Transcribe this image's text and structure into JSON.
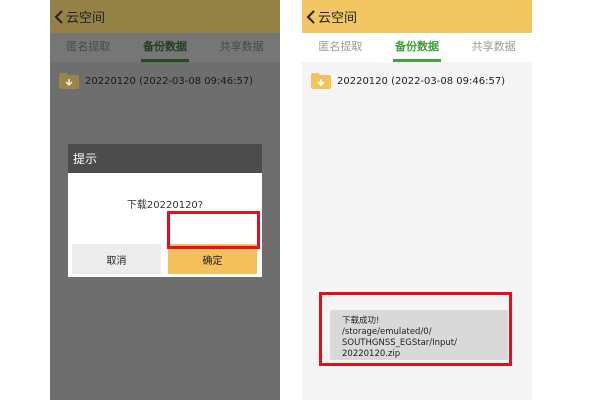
{
  "colors": {
    "header_bg": "#f2c662",
    "header_bg_dimmed": "#938146",
    "tabbar_bg": "#ffffff",
    "tabbar_bg_dimmed": "#767676",
    "content_bg": "#f5f5f5",
    "content_bg_dimmed": "#6e6e6e",
    "tab_active": "#3f9f3a",
    "tab_active_dimmed": "#233f20",
    "tab_inactive": "#9a9a9a",
    "tab_inactive_dimmed": "#4a4a4a",
    "underline": "#43a43c",
    "underline_dimmed": "#264c22",
    "text_dark": "#222222",
    "file_text_dimmed": "#1a1a1a",
    "folder": "#f3c558",
    "folder_dimmed": "#9a8546",
    "dialog_head_bg": "#4c4c4c",
    "dialog_title": "#ffffff",
    "dialog_body_bg": "#ffffff",
    "dialog_msg_text": "#333333",
    "cancel_bg": "#ececec",
    "ok_bg": "#f3c05b",
    "highlight": "#e0101e",
    "toast_bg": "#d9d9d9",
    "toast_text": "#222222"
  },
  "app": {
    "title": "云空间",
    "tabs": [
      {
        "label": "匿名提取",
        "active": false
      },
      {
        "label": "备份数据",
        "active": true
      },
      {
        "label": "共享数据",
        "active": false
      }
    ],
    "file": {
      "name": "20220120 (2022-03-08 09:46:57)",
      "icon": "folder-icon"
    }
  },
  "dialog": {
    "title": "提示",
    "message": "下载20220120?",
    "cancel_label": "取消",
    "ok_label": "确定"
  },
  "toast": {
    "lines": [
      "下载成功!",
      "/storage/emulated/0/",
      "SOUTHGNSS_EGStar/Input/",
      "20220120.zip"
    ]
  }
}
